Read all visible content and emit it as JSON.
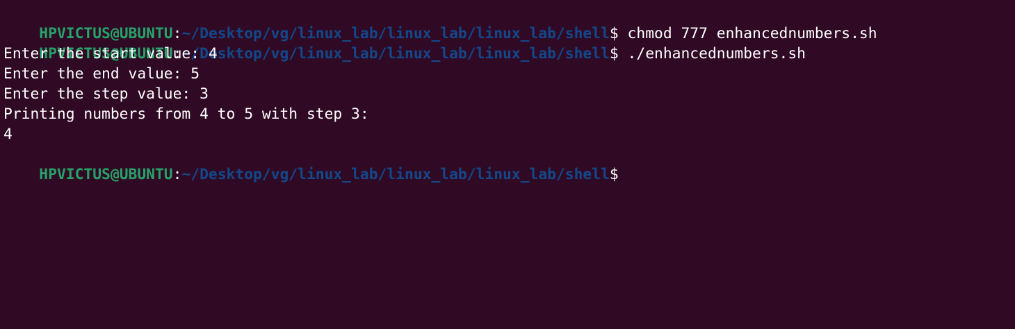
{
  "colors": {
    "background": "#300a24",
    "user_host": "#26a269",
    "path": "#12488b",
    "text": "#ffffff"
  },
  "terminal": {
    "lines": [
      {
        "type": "prompt",
        "user_host": "HPVICTUS@UBUNTU",
        "separator": ":",
        "path": "~/Desktop/vg/linux_lab/linux_lab/linux_lab/shell",
        "symbol": "$",
        "command": " chmod 777 enhancednumbers.sh"
      },
      {
        "type": "prompt",
        "user_host": "HPVICTUS@UBUNTU",
        "separator": ":",
        "path": "~/Desktop/vg/linux_lab/linux_lab/linux_lab/shell",
        "symbol": "$",
        "command": " ./enhancednumbers.sh"
      },
      {
        "type": "output",
        "text": "Enter the start value: 4"
      },
      {
        "type": "output",
        "text": "Enter the end value: 5"
      },
      {
        "type": "output",
        "text": "Enter the step value: 3"
      },
      {
        "type": "output",
        "text": "Printing numbers from 4 to 5 with step 3:"
      },
      {
        "type": "output",
        "text": "4"
      },
      {
        "type": "prompt",
        "user_host": "HPVICTUS@UBUNTU",
        "separator": ":",
        "path": "~/Desktop/vg/linux_lab/linux_lab/linux_lab/shell",
        "symbol": "$",
        "command": ""
      }
    ]
  }
}
